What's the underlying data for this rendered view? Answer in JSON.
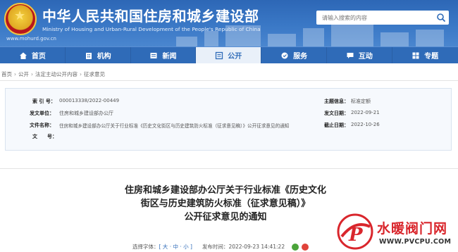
{
  "header": {
    "title_cn": "中华人民共和国住房和城乡建设部",
    "title_en": "Ministry of Housing and Urban-Rural Development of the People's Republic of China",
    "site_url": "www.mohurd.gov.cn",
    "search_placeholder": "请输入搜索的内容"
  },
  "nav": [
    {
      "label": "首页",
      "icon": "home-icon"
    },
    {
      "label": "机构",
      "icon": "building-icon"
    },
    {
      "label": "新闻",
      "icon": "news-icon"
    },
    {
      "label": "公开",
      "icon": "open-icon",
      "active": true
    },
    {
      "label": "服务",
      "icon": "service-icon"
    },
    {
      "label": "互动",
      "icon": "chat-icon"
    },
    {
      "label": "专题",
      "icon": "topic-icon"
    }
  ],
  "breadcrumb": [
    "首页",
    "公开",
    "法定主动公开内容",
    "征求意见"
  ],
  "info": {
    "index_label": "索 引 号：",
    "index_value": "000013338/2022-00449",
    "category_label": "主题信息：",
    "category_value": "标准定额",
    "issuer_label": "发文单位：",
    "issuer_value": "住房和城乡建设部办公厅",
    "date_label": "发文日期：",
    "date_value": "2022-09-21",
    "filename_label": "文件名称：",
    "filename_value": "住房和城乡建设部办公厅关于行业标准《历史文化街区与历史建筑防火标准（征求意见稿）》公开征求意见的通知",
    "deadline_label": "截止日期：",
    "deadline_value": "2022-10-26",
    "docno_label": "文　　号：",
    "docno_value": ""
  },
  "article": {
    "title_line1": "住房和城乡建设部办公厅关于行业标准《历史文化",
    "title_line2": "街区与历史建筑防火标准（征求意见稿）》",
    "title_line3": "公开征求意见的通知",
    "font_size_label": "选择字体：",
    "font_size_options": "[ 大 · 中 · 小 ]",
    "publish_label": "发布时间：",
    "publish_time": "2022-09-23 14:41:22"
  },
  "watermark": {
    "text_cn": "水暖阀门网",
    "url": "WWW.PVCPU.COM",
    "logo_letter": "P"
  },
  "colors": {
    "header_blue": "#2d67b6",
    "nav_blue": "#2f6bb8",
    "watermark_red": "#d9262c"
  }
}
